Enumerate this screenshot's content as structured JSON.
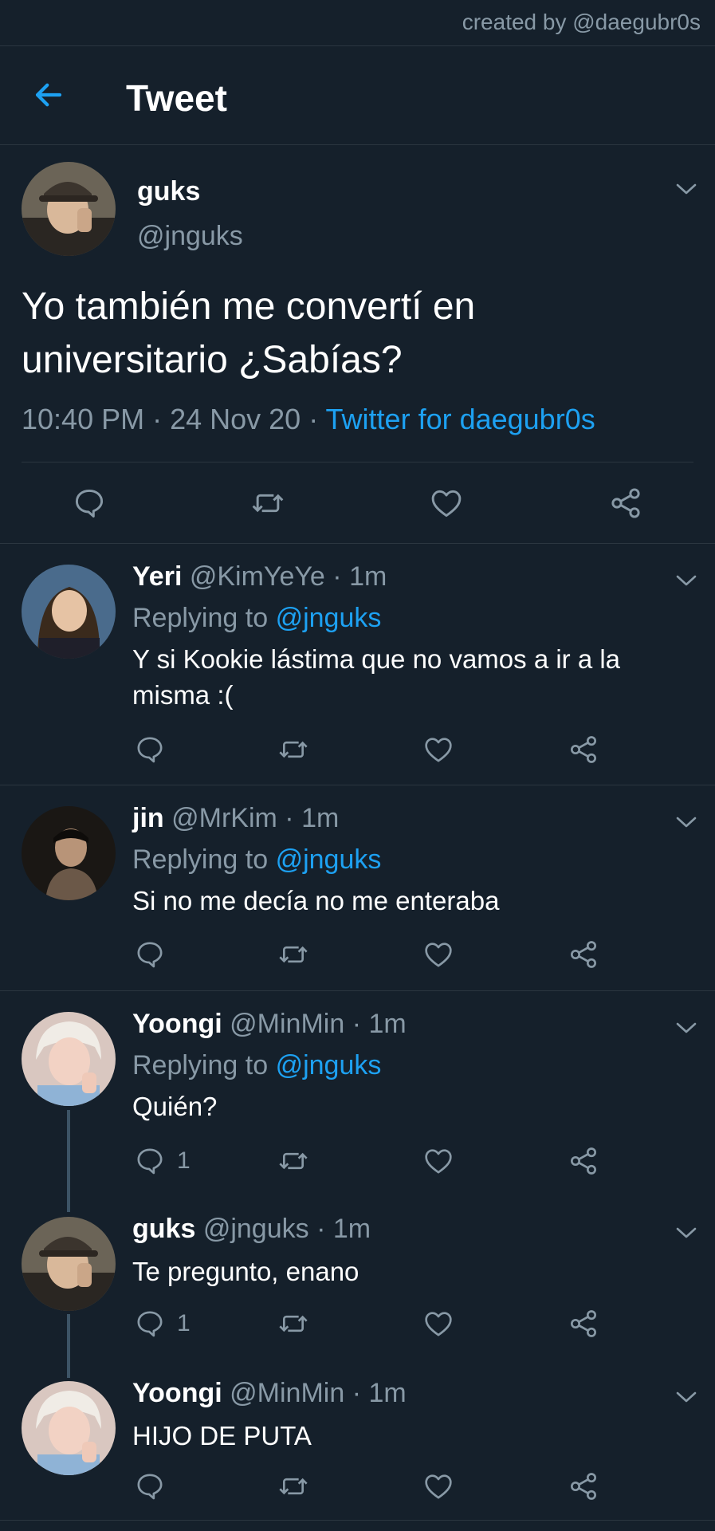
{
  "credit": "created by @daegubr0s",
  "header": {
    "title": "Tweet"
  },
  "main_tweet": {
    "name": "guks",
    "handle": "@jnguks",
    "text": "Yo también me convertí en universitario ¿Sabías?",
    "time": "10:40 PM",
    "date": "24 Nov 20",
    "source": "Twitter for daegubr0s"
  },
  "replies": [
    {
      "name": "Yeri",
      "handle": "@KimYeYe",
      "time": "1m",
      "replying_prefix": "Replying to",
      "replying_to": "@jnguks",
      "text": "Y si Kookie lástima que no vamos a ir a la misma :(",
      "reply_count": ""
    },
    {
      "name": "jin",
      "handle": "@MrKim",
      "time": "1m",
      "replying_prefix": "Replying to",
      "replying_to": "@jnguks",
      "text": "Si no me decía no me enteraba",
      "reply_count": ""
    },
    {
      "name": "Yoongi",
      "handle": "@MinMin",
      "time": "1m",
      "replying_prefix": "Replying to",
      "replying_to": "@jnguks",
      "text": "Quién?",
      "reply_count": "1"
    },
    {
      "name": "guks",
      "handle": "@jnguks",
      "time": "1m",
      "text": "Te pregunto, enano",
      "reply_count": "1"
    },
    {
      "name": "Yoongi",
      "handle": "@MinMin",
      "time": "1m",
      "text": "HIJO DE PUTA",
      "reply_count": ""
    }
  ],
  "colors": {
    "background": "#15202b",
    "accent": "#1da1f2",
    "muted": "#8899a6",
    "divider": "#2b3640"
  },
  "icons": [
    "back-arrow-icon",
    "chevron-down-icon",
    "reply-icon",
    "retweet-icon",
    "like-icon",
    "share-icon"
  ]
}
